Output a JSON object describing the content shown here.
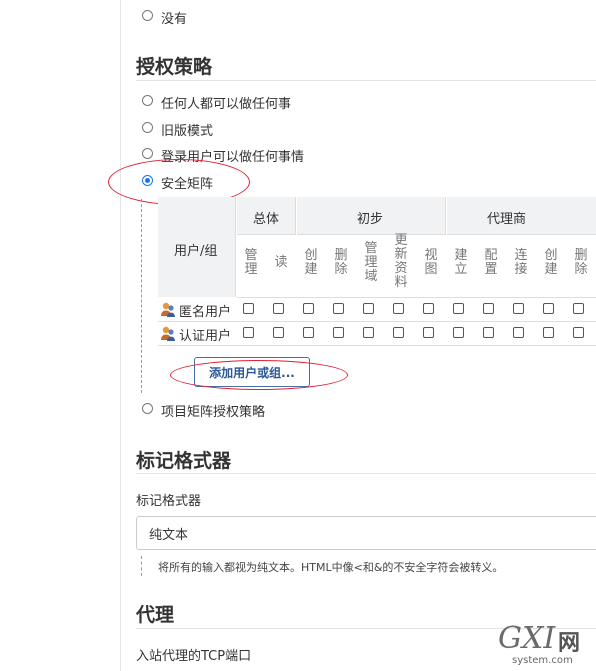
{
  "top_option": "没有",
  "authorization": {
    "heading": "授权策略",
    "options": [
      "任何人都可以做任何事",
      "旧版模式",
      "登录用户可以做任何事情",
      "安全矩阵",
      "项目矩阵授权策略"
    ],
    "selected": "安全矩阵"
  },
  "matrix": {
    "user_group_header": "用户/组",
    "groups": [
      "总体",
      "初步",
      "代理商"
    ],
    "permissions": [
      "管理",
      "读",
      "创建",
      "删除",
      "管理域",
      "更新资料",
      "视图",
      "建立",
      "配置",
      "连接",
      "创建",
      "删除"
    ],
    "rows": [
      "匿名用户",
      "认证用户"
    ],
    "add_button": "添加用户或组..."
  },
  "markup": {
    "heading": "标记格式器",
    "label": "标记格式器",
    "value": "纯文本",
    "help": "将所有的输入都视为纯文本。HTML中像<和&的不安全字符会被转义。"
  },
  "proxy": {
    "heading": "代理",
    "label": "入站代理的TCP端口"
  },
  "watermark": {
    "logo_text": "GXI",
    "suffix": "网",
    "domain": "system.com"
  },
  "colors": {
    "accent": "#1a73e8",
    "annotation": "#dd2233",
    "header_bg": "#f0f2f4"
  }
}
